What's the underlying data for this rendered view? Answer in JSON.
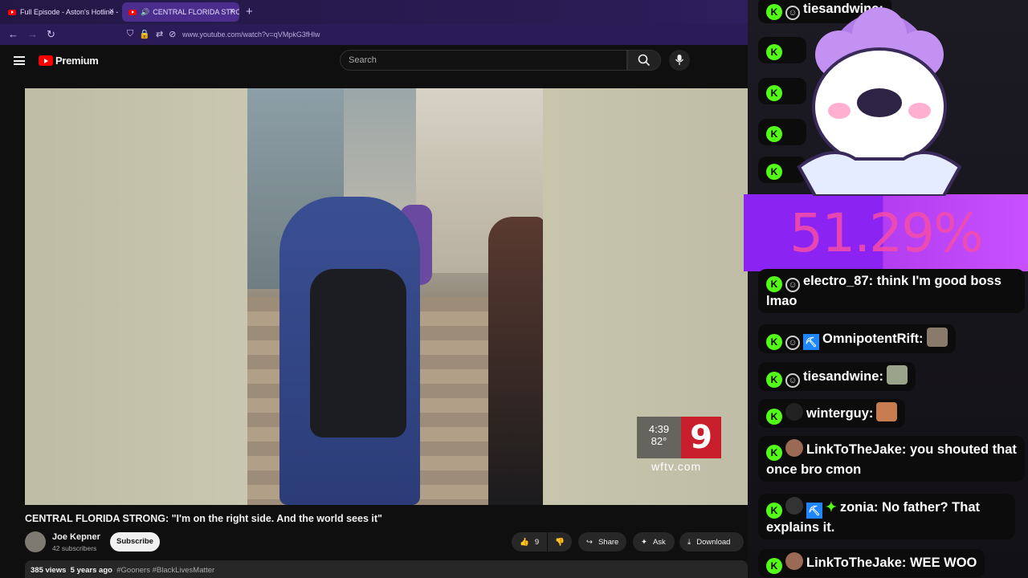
{
  "browser": {
    "tabs": [
      {
        "label": "Full Episode - Aston's Hotline -",
        "active": false
      },
      {
        "label": "CENTRAL FLORIDA STRONG",
        "active": true
      }
    ],
    "new_tab_label": "+",
    "url": "www.youtube.com/watch?v=qVMpkG3fHlw",
    "colors": {
      "tabbar": "#2a1c55",
      "active_tab": "#4a2d8c"
    }
  },
  "youtube": {
    "logo_text": "Premium",
    "search_placeholder": "Search",
    "video": {
      "overlay_time": "4:39",
      "overlay_temp": "82°",
      "overlay_channel_number": "9",
      "overlay_site": "wftv.com"
    },
    "title": "CENTRAL FLORIDA STRONG: \"I'm on the right side. And the world sees it\"",
    "channel": {
      "name": "Joe Kepner",
      "subscribers": "42 subscribers"
    },
    "subscribe_label": "Subscribe",
    "actions": {
      "likes": "9",
      "share": "Share",
      "ask": "Ask",
      "download": "Download"
    },
    "description": {
      "views": "385 views",
      "age": "5 years ago",
      "tags": "#Gooners #BlackLivesMatter"
    }
  },
  "overlay": {
    "percent": "51.29%",
    "percent_value": 51.29,
    "colors": {
      "percent_bg": "#8b24f2",
      "percent_text": "#f64da8",
      "kick_badge": "#53fc18"
    }
  },
  "chat": [
    {
      "user": "tiesandwine:",
      "message": "",
      "badge": "person",
      "top": 0
    },
    {
      "user": "electro_87:",
      "message": "think I'm good boss lmao",
      "badge": "person"
    },
    {
      "user": "OmnipotentRift:",
      "message": "",
      "badge": "sub"
    },
    {
      "user": "tiesandwine:",
      "message": "",
      "badge": "person"
    },
    {
      "user": "winterguy:",
      "message": "",
      "badge": "avatar"
    },
    {
      "user": "LinkToTheJake:",
      "message": "you shouted that once bro cmon",
      "badge": "avatar"
    },
    {
      "user": "zonia:",
      "message": "No father? That explains it.",
      "badge": "sub"
    },
    {
      "user": "LinkToTheJake:",
      "message": "WEE WOO",
      "badge": "avatar"
    }
  ]
}
